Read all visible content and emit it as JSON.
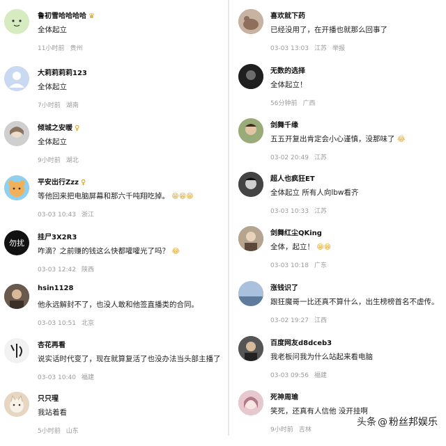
{
  "left_comments": [
    {
      "name": "鲁初雪哈哈哈哈",
      "badge": "crown",
      "text": "全体起立",
      "time": "11小时前",
      "location": "贵州",
      "avatar_color": "#cfe7b8",
      "avatar_label": ""
    },
    {
      "name": "大莉莉莉莉123",
      "badge": "",
      "text": "全体起立",
      "time": "7小时前",
      "location": "湖南",
      "avatar_color": "#c9d9f2",
      "avatar_label": ""
    },
    {
      "name": "倾城之安暖",
      "badge": "pin",
      "text": "全体起立",
      "time": "9小时前",
      "location": "湖北",
      "avatar_color": "#bfbfbf",
      "avatar_label": ""
    },
    {
      "name": "平安出行Zzz",
      "badge": "pin",
      "text": "等他回来把电脑屏幕和那六千吨翔吃掉。",
      "emoji": "😁😁😁",
      "time": "03-03 10:43",
      "location": "浙江",
      "avatar_color": "#f1b15a",
      "avatar_label": ""
    },
    {
      "name": "挂尸3X2R3",
      "badge": "",
      "text": "咋滴？之前赚的钱这么快都嚯嚯光了吗？",
      "emoji": "😂",
      "time": "03-03 12:42",
      "location": "陕西",
      "avatar_color": "#111111",
      "avatar_label": "勿扰"
    },
    {
      "name": "hsin1128",
      "badge": "",
      "text": "他永远解封不了，也没人敢和他签直播类的合同。",
      "emoji": "",
      "time": "03-03 10:51",
      "location": "北京",
      "avatar_color": "#5a4b3f",
      "avatar_label": ""
    },
    {
      "name": "杏花再看",
      "badge": "",
      "text": "说实话时代变了，现在就算复活了也没办法当头部主播了",
      "emoji": "",
      "time": "03-03 10:40",
      "location": "福建",
      "avatar_color": "#e5e5e5",
      "avatar_label": ""
    },
    {
      "name": "只只瑆",
      "badge": "",
      "text": "我站着看",
      "emoji": "",
      "time": "5小时前",
      "location": "山东",
      "avatar_color": "#d9c8b3",
      "avatar_label": ""
    }
  ],
  "right_comments": [
    {
      "name": "喜欢就下药",
      "text": "已经没用了，在开播也就那么回事了",
      "emoji": "",
      "time": "03-03 13:03",
      "location": "江苏",
      "report": "举报",
      "avatar_color": "#b99a86"
    },
    {
      "name": "无数的选择",
      "text": "全体起立！",
      "emoji": "",
      "time": "56分钟前",
      "location": "广西",
      "report": "",
      "avatar_color": "#2a2a2a"
    },
    {
      "name": "剑舞千缘",
      "text": "五五开复出肯定会小心谨慎，没那味了",
      "emoji": "😂",
      "time": "03-02 20:49",
      "location": "江苏",
      "report": "",
      "avatar_color": "#7d9160"
    },
    {
      "name": "超人也疯狂ET",
      "text": "全体起立 所有人向lbw看齐",
      "emoji": "",
      "time": "03-03 10:33",
      "location": "江苏",
      "report": "",
      "avatar_color": "#3a3a3a"
    },
    {
      "name": "剑舞红尘QKing",
      "text": "全体，起立！",
      "emoji": "😁😁",
      "time": "03-03 10:18",
      "location": "广东",
      "report": "",
      "avatar_color": "#8a7a6a"
    },
    {
      "name": "涨钱识了",
      "text": "跟狂魔哥一比还真不算什么，出生榜榜首名不虚传。",
      "emoji": "",
      "time": "03-02 19:27",
      "location": "江西",
      "report": "",
      "avatar_color": "#8ea8c8"
    },
    {
      "name": "百度网友d8dceb3",
      "text": "我老板问我为什么站起来看电脑",
      "emoji": "",
      "time": "03-03 09:56",
      "location": "福建",
      "report": "",
      "avatar_color": "#3f3f3f"
    },
    {
      "name": "死神周瑜",
      "text": "笑死，还真有人信他 没开挂啊",
      "emoji": "",
      "time": "9小时前",
      "location": "吉林",
      "report": "",
      "avatar_color": "#c7a0a8"
    }
  ],
  "watermark": {
    "prefix": "头条",
    "at": "@",
    "account": "粉丝邦娱乐"
  }
}
